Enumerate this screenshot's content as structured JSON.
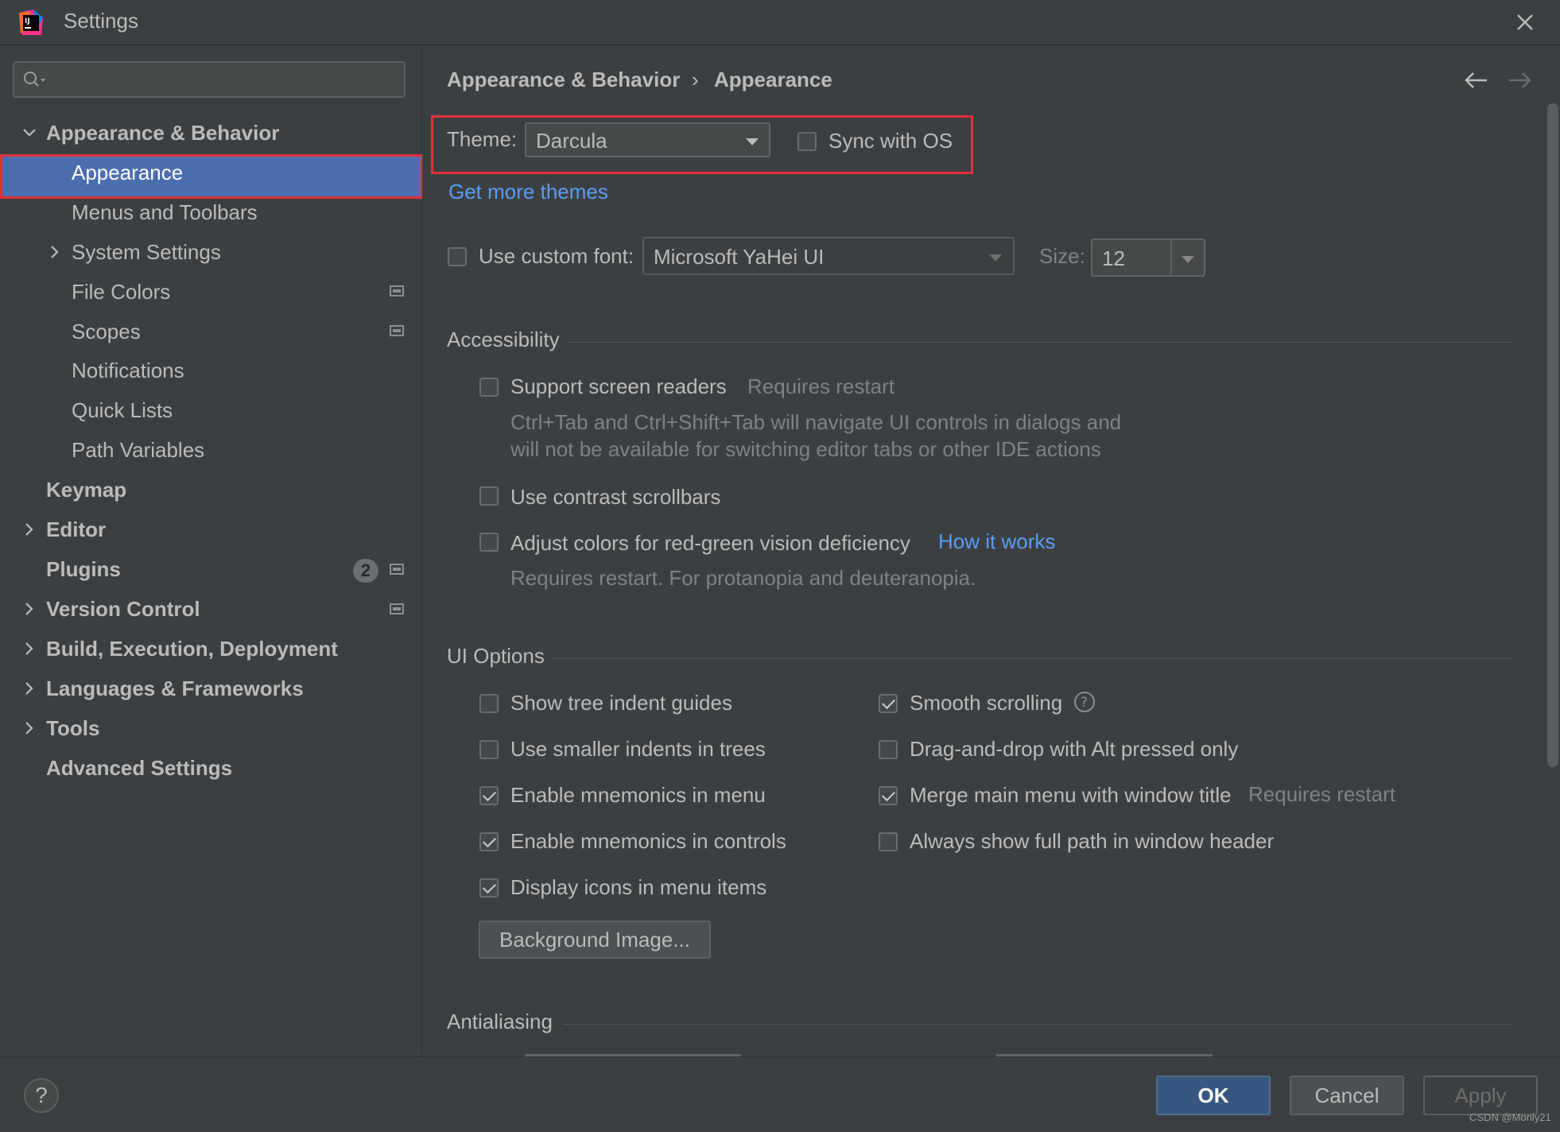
{
  "window": {
    "title": "Settings"
  },
  "search": {
    "placeholder": ""
  },
  "sidebar": {
    "items": [
      {
        "label": "Appearance & Behavior"
      },
      {
        "label": "Appearance"
      },
      {
        "label": "Menus and Toolbars"
      },
      {
        "label": "System Settings"
      },
      {
        "label": "File Colors"
      },
      {
        "label": "Scopes"
      },
      {
        "label": "Notifications"
      },
      {
        "label": "Quick Lists"
      },
      {
        "label": "Path Variables"
      },
      {
        "label": "Keymap"
      },
      {
        "label": "Editor"
      },
      {
        "label": "Plugins",
        "badge": "2"
      },
      {
        "label": "Version Control"
      },
      {
        "label": "Build, Execution, Deployment"
      },
      {
        "label": "Languages & Frameworks"
      },
      {
        "label": "Tools"
      },
      {
        "label": "Advanced Settings"
      }
    ]
  },
  "breadcrumb": {
    "parent": "Appearance & Behavior",
    "separator": "›",
    "current": "Appearance"
  },
  "theme": {
    "label": "Theme:",
    "value": "Darcula",
    "sync_label": "Sync with OS",
    "get_more": "Get more themes"
  },
  "font": {
    "use_custom_label": "Use custom font:",
    "font_value": "Microsoft YaHei UI",
    "size_label": "Size:",
    "size_value": "12"
  },
  "accessibility": {
    "title": "Accessibility",
    "screen_readers": "Support screen readers",
    "requires_restart": "Requires restart",
    "desc_line1": "Ctrl+Tab and Ctrl+Shift+Tab will navigate UI controls in dialogs and",
    "desc_line2": "will not be available for switching editor tabs or other IDE actions",
    "contrast_scrollbars": "Use contrast scrollbars",
    "adjust_colors": "Adjust colors for red-green vision deficiency",
    "how_it_works": "How it works",
    "adjust_desc": "Requires restart. For protanopia and deuteranopia."
  },
  "ui_options": {
    "title": "UI Options",
    "left": [
      {
        "label": "Show tree indent guides",
        "checked": false
      },
      {
        "label": "Use smaller indents in trees",
        "checked": false
      },
      {
        "label": "Enable mnemonics in menu",
        "checked": true
      },
      {
        "label": "Enable mnemonics in controls",
        "checked": true
      },
      {
        "label": "Display icons in menu items",
        "checked": true
      }
    ],
    "right": [
      {
        "label": "Smooth scrolling",
        "checked": true
      },
      {
        "label": "Drag-and-drop with Alt pressed only",
        "checked": false
      },
      {
        "label": "Merge main menu with window title",
        "checked": true,
        "note": "Requires restart"
      },
      {
        "label": "Always show full path in window header",
        "checked": false
      }
    ],
    "background_image": "Background Image..."
  },
  "antialiasing": {
    "title": "Antialiasing"
  },
  "footer": {
    "help": "?",
    "ok": "OK",
    "cancel": "Cancel",
    "apply": "Apply"
  },
  "watermark": "CSDN @Monly21",
  "colors": {
    "accent": "#4b6eaf",
    "link": "#589df6",
    "highlight_box": "#e0313a",
    "background": "#3c3f41"
  }
}
